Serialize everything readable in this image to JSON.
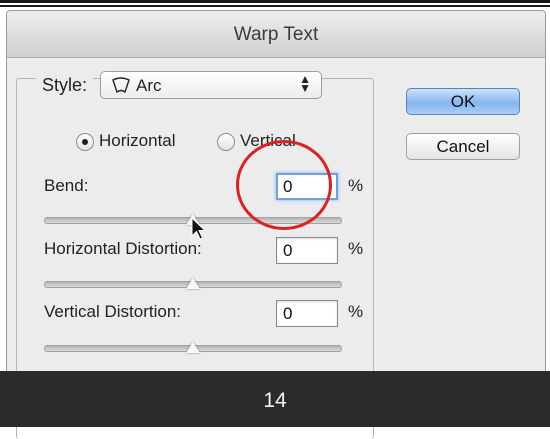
{
  "dialog": {
    "title": "Warp Text",
    "style_label": "Style:",
    "style_value": "Arc",
    "style_icon": "arc-icon",
    "ok_label": "OK",
    "cancel_label": "Cancel",
    "orientation": {
      "horizontal_label": "Horizontal",
      "vertical_label": "Vertical",
      "selected": "Horizontal"
    },
    "bend": {
      "label": "Bend:",
      "value": "0",
      "unit": "%",
      "slider_level": 0.5
    },
    "horizontal_distortion": {
      "label": "Horizontal Distortion:",
      "value": "0",
      "unit": "%",
      "slider_level": 0.5
    },
    "vertical_distortion": {
      "label": "Vertical Distortion:",
      "value": "0",
      "unit": "%",
      "slider_level": 0.5
    }
  },
  "caption": {
    "page_number": "14"
  },
  "colors": {
    "ok_button": "#86b6ef",
    "highlight_circle": "#e02020",
    "caption_bar": "#2b2b2b"
  }
}
